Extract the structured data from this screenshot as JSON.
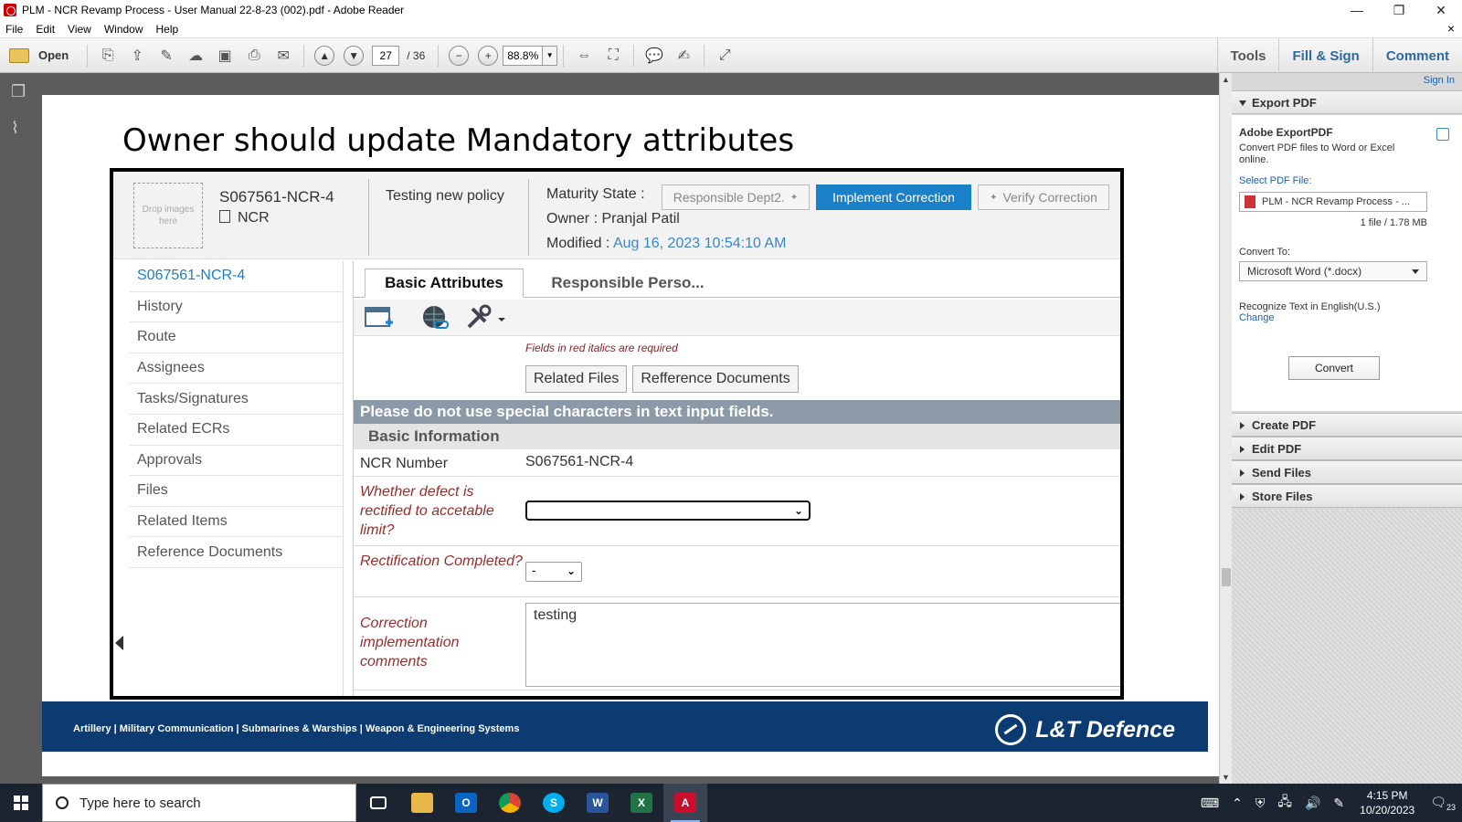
{
  "window": {
    "title": "PLM - NCR Revamp Process - User Manual 22-8-23 (002).pdf - Adobe Reader",
    "minimize": "—",
    "maximize": "❐",
    "close": "✕"
  },
  "menu": {
    "items": [
      "File",
      "Edit",
      "View",
      "Window",
      "Help"
    ],
    "close_doc": "×"
  },
  "toolbar": {
    "open_label": "Open",
    "page_current": "27",
    "page_total": "/ 36",
    "zoom": "88.8%",
    "tools_label": "Tools",
    "fill_sign_label": "Fill & Sign",
    "comment_label": "Comment"
  },
  "slide": {
    "title": "Owner should update Mandatory attributes",
    "footer_text": "Artillery | Military Communication | Submarines & Warships | Weapon & Engineering Systems",
    "logo_text": "L&T Defence"
  },
  "record": {
    "drop_images": "Drop images here",
    "id": "S067561-NCR-4",
    "type": "NCR",
    "description": "Testing new policy",
    "maturity_label": "Maturity State :",
    "states": [
      "Responsible Dept2.",
      "Implement Correction",
      "Verify Correction"
    ],
    "owner": "Owner : Pranjal Patil",
    "modified_label": "Modified :",
    "modified_date": "Aug 16, 2023 10:54:10 AM"
  },
  "nav": {
    "items": [
      "S067561-NCR-4",
      "History",
      "Route",
      "Assignees",
      "Tasks/Signatures",
      "Related ECRs",
      "Approvals",
      "Files",
      "Related Items",
      "Reference Documents"
    ]
  },
  "content": {
    "tabs": [
      "Basic Attributes",
      "Responsible Perso..."
    ],
    "required_note": "Fields in red italics are required",
    "buttons": [
      "Related Files",
      "Refference Documents"
    ],
    "banner": "Please do not use special characters in text input fields.",
    "section": "Basic Information",
    "fields": {
      "ncr_number_label": "NCR Number",
      "ncr_number_value": "S067561-NCR-4",
      "defect_label": "Whether defect is rectified to accetable limit?",
      "rectification_label": "Rectification Completed?",
      "rectification_value": "-",
      "comments_label": "Correction implementation comments",
      "comments_value": "testing"
    }
  },
  "right_panel": {
    "sign_in": "Sign In",
    "export_pdf": "Export PDF",
    "export_title": "Adobe ExportPDF",
    "export_desc": "Convert PDF files to Word or Excel online.",
    "select_label": "Select PDF File:",
    "file_name": "PLM - NCR Revamp Process - ...",
    "file_size": "1 file / 1.78 MB",
    "convert_to_label": "Convert To:",
    "convert_to_value": "Microsoft Word (*.docx)",
    "recognize": "Recognize Text in English(U.S.)",
    "change": "Change",
    "convert_button": "Convert",
    "sections": [
      "Create PDF",
      "Edit PDF",
      "Send Files",
      "Store Files"
    ]
  },
  "taskbar": {
    "search_placeholder": "Type here to search",
    "time": "4:15 PM",
    "date": "10/20/2023",
    "notifications": "23"
  },
  "colors": {
    "accent_blue": "#1a80c8",
    "required_red": "#9b2b2b",
    "banner_gray": "#8c9aa8",
    "footer_navy": "#0c3b72"
  }
}
